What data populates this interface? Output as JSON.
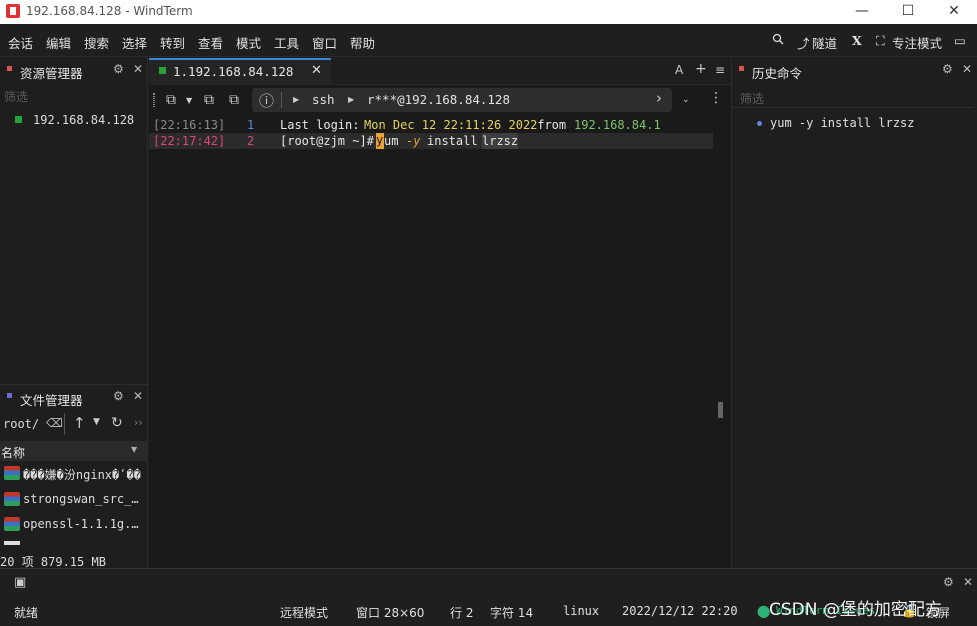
{
  "window": {
    "title": "192.168.84.128 - WindTerm",
    "minimize": "—",
    "maximize": "☐",
    "close": "✕"
  },
  "menu": {
    "items": [
      "会话",
      "编辑",
      "搜索",
      "选择",
      "转到",
      "查看",
      "模式",
      "工具",
      "窗口",
      "帮助"
    ],
    "tunnel": "隧道",
    "x_label": "X",
    "focus_mode": "专注模式"
  },
  "resource_manager": {
    "title": "资源管理器",
    "filter_placeholder": "筛选",
    "items": [
      "192.168.84.128"
    ]
  },
  "file_manager": {
    "title": "文件管理器",
    "path": "root/",
    "column_name": "名称",
    "files": [
      "���嫌�汾nginx�ʹ��",
      "strongswan_src_…",
      "openssl-1.1.1g.…"
    ],
    "summary": "20 项 879.15 MB"
  },
  "tabs": {
    "active_label": "1.192.168.84.128",
    "font_btn": "A",
    "add_btn": "+",
    "menu_btn": "≡"
  },
  "toolbar": {
    "protocol": "ssh",
    "target": "r***@192.168.84.128"
  },
  "terminal": {
    "lines": [
      {
        "time": "[22:16:13]",
        "num": "1",
        "text_a": "Last login: ",
        "text_b": "Mon Dec 12 22:11:26 2022",
        "text_c": " from ",
        "text_d": "192.168.84.1"
      },
      {
        "time": "[22:17:42]",
        "num": "2",
        "prompt": "[root@zjm ~]#",
        "cmd_y": "y",
        "cmd_um": "um",
        "flag": "-y",
        "word": "install",
        "arg": "lrzsz"
      }
    ]
  },
  "history": {
    "title": "历史命令",
    "filter_placeholder": "筛选",
    "items": [
      "yum -y install lrzsz"
    ]
  },
  "status": {
    "ready": "就绪",
    "mode": "远程模式",
    "window_size": "窗口 28×60",
    "row": "行 2",
    "col": "字符 14",
    "os": "linux",
    "datetime": "2022/12/12 22:20",
    "session": "WindTerm Issues",
    "lock": "锁屏",
    "watermark": "CSDN @堡的加密配方"
  },
  "colors": {
    "accent": "#3b86d6",
    "session_green": "#25a33a",
    "timestamp_grey": "#8a8a8a",
    "timestamp_pink": "#e0457b",
    "date_yellow": "#e5d45a",
    "ip_green": "#7ec46a",
    "cursor_orange": "#e8a23a"
  }
}
